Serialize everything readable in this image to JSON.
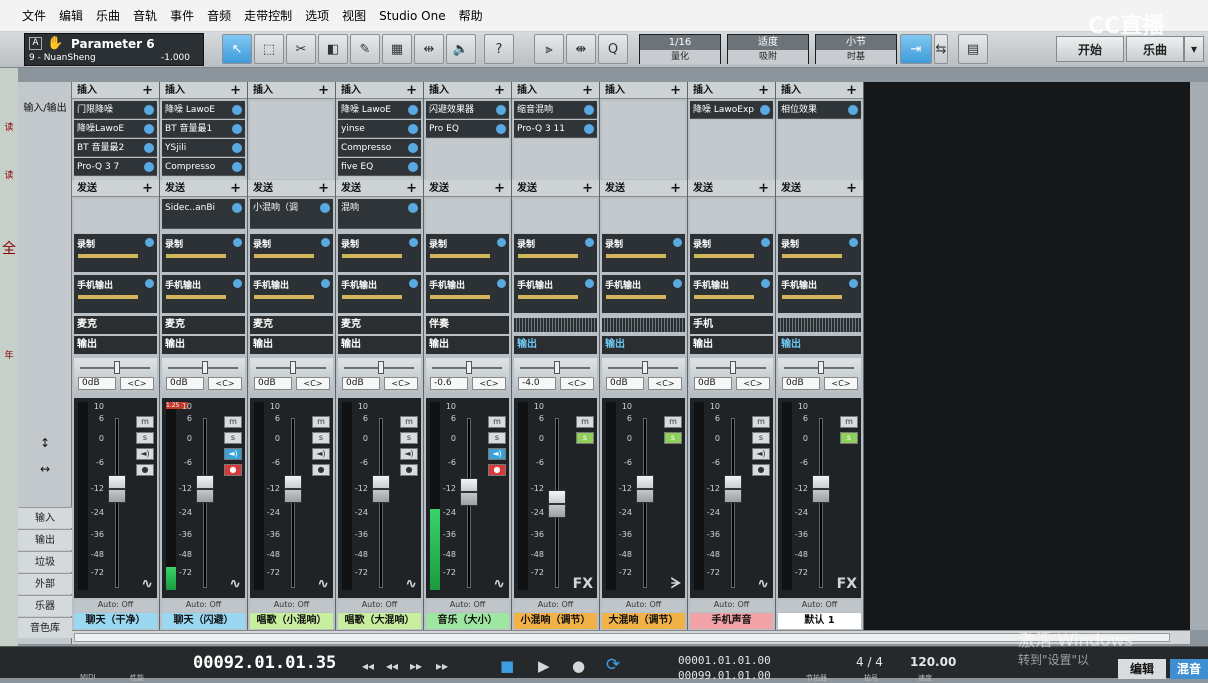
{
  "menu": [
    "文件",
    "编辑",
    "乐曲",
    "音轨",
    "事件",
    "音频",
    "走带控制",
    "选项",
    "视图",
    "Studio One",
    "帮助"
  ],
  "param": {
    "title": "Parameter 6",
    "instrument": "9 - NuanSheng",
    "value": "-1.000",
    "a_label": "A"
  },
  "quantize": {
    "value": "1/16",
    "label": "量化"
  },
  "snap": {
    "value": "适度",
    "label": "吸附"
  },
  "timebase": {
    "value": "小节",
    "label": "时基"
  },
  "top_buttons": {
    "start": "开始",
    "song": "乐曲",
    "help": "?"
  },
  "left_panel_labels": [
    "读",
    "读",
    "全",
    "年"
  ],
  "nav": {
    "io": "输入/输出",
    "input": "输入",
    "output": "输出",
    "trash": "垃圾",
    "external": "外部",
    "instrument": "乐器",
    "library": "音色库"
  },
  "insert_label": "插入",
  "send_label": "发送",
  "rec_label": "录制",
  "phone_label": "手机输出",
  "output_label": "输出",
  "auto_label": "Auto: Off",
  "scale_marks": [
    "10",
    "6",
    "0",
    "-6",
    "-12",
    "-24",
    "-36",
    "-48",
    "-72"
  ],
  "meter_clip": "1.25",
  "fx_icon_label": "FX",
  "btn_labels": {
    "mute": "m",
    "solo": "s",
    "monitor": "◄)",
    "record": "●"
  },
  "channels": [
    {
      "name": "聊天（干净）",
      "color": "#9ad8f2",
      "inserts": [
        "门限降噪",
        "降噪LawoE",
        "BT 音量最2",
        "Pro-Q 3 7"
      ],
      "sends": [],
      "input": "麦克",
      "output": "输出",
      "volume": "0dB",
      "pan": "<C>",
      "level": 0.0,
      "fader": 0.62
    },
    {
      "name": "聊天（闪避）",
      "color": "#9ad8f2",
      "inserts": [
        "降噪 LawoE",
        "BT 音量最1",
        "YSjili",
        "Compresso"
      ],
      "sends": [
        "Sidec..anBi"
      ],
      "input": "麦克",
      "output": "输出",
      "volume": "0dB",
      "pan": "<C>",
      "level": 0.12,
      "fader": 0.62
    },
    {
      "name": "唱歌（小混响）",
      "color": "#c7ef9f",
      "inserts": [],
      "sends": [
        "小混响（调"
      ],
      "input": "麦克",
      "output": "输出",
      "volume": "0dB",
      "pan": "<C>",
      "level": 0.0,
      "fader": 0.62
    },
    {
      "name": "唱歌（大混响）",
      "color": "#c7ef9f",
      "inserts": [
        "降噪 LawoE",
        "yinse",
        "Compresso",
        "five EQ"
      ],
      "sends": [
        "混响"
      ],
      "input": "麦克",
      "output": "输出",
      "volume": "0dB",
      "pan": "<C>",
      "level": 0.0,
      "fader": 0.62
    },
    {
      "name": "音乐（大小）",
      "color": "#9ee6a2",
      "inserts": [
        "闪避效果器",
        "Pro EQ"
      ],
      "sends": [],
      "input": "伴奏",
      "output": "输出",
      "volume": "-0.6",
      "pan": "<C>",
      "level": 0.43,
      "fader": 0.6
    },
    {
      "name": "小混响（调节）",
      "color": "#f2b248",
      "inserts": [
        "缩音混响",
        "Pro-Q 3 11"
      ],
      "sends": [],
      "input": "",
      "output": "输出",
      "volume": "-4.0",
      "pan": "<C>",
      "level": 0.0,
      "fader": 0.52
    },
    {
      "name": "大混响（调节）",
      "color": "#f2b248",
      "inserts": [],
      "sends": [],
      "input": "",
      "output": "输出",
      "volume": "0dB",
      "pan": "<C>",
      "level": 0.0,
      "fader": 0.62
    },
    {
      "name": "手机声音",
      "color": "#f2a3a8",
      "inserts": [
        "降噪 LawoExp"
      ],
      "sends": [],
      "input": "手机",
      "output": "输出",
      "volume": "0dB",
      "pan": "<C>",
      "level": 0.0,
      "fader": 0.62
    },
    {
      "name": "默认 1",
      "color": "#ffffff",
      "inserts": [
        "相位效果"
      ],
      "sends": [],
      "input": "",
      "output": "输出",
      "volume": "0dB",
      "pan": "<C>",
      "level": 0.0,
      "fader": 0.62
    }
  ],
  "transport": {
    "time": "00092.01.01.35",
    "pos1": "00001.01.01.00",
    "pos2": "00099.01.01.00",
    "signature": "4 / 4",
    "tempo": "120.00",
    "edit": "编辑",
    "mix": "混音",
    "midi_label": "MIDI",
    "perf_label": "性能",
    "metro_label": "节拍器",
    "timing_label": "拍号",
    "tempo_label": "速度"
  },
  "watermark": {
    "brand": "CC直播",
    "line1": "激活 Windows",
    "line2": "转到\"设置\"以"
  }
}
